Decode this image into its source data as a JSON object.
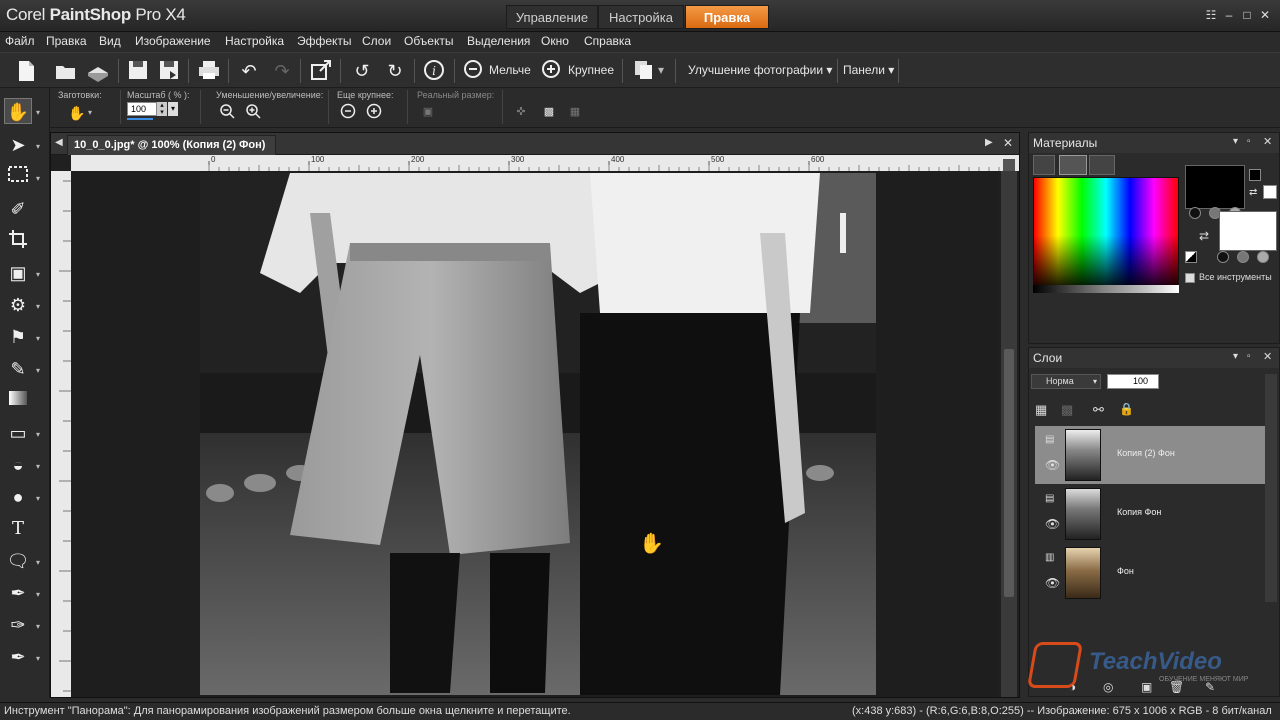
{
  "app": {
    "title_light": "Corel ",
    "title_bold": "PaintShop",
    "title_rest": " Pro X4"
  },
  "workspace_tabs": [
    {
      "label": "Управление"
    },
    {
      "label": "Настройка"
    },
    {
      "label": "Правка"
    }
  ],
  "window_buttons": {
    "grid_icon": "☷",
    "minimize": "–",
    "maximize": "□",
    "close": "✕"
  },
  "menu": [
    "Файл",
    "Правка",
    "Вид",
    "Изображение",
    "Настройка",
    "Эффекты",
    "Слои",
    "Объекты",
    "Выделения",
    "Окно",
    "Справка"
  ],
  "toolbar": {
    "zoom_out_label": "Мельче",
    "zoom_in_label": "Крупнее",
    "enhance_label": "Улучшение фотографии",
    "panels_label": "Панели"
  },
  "options": {
    "presets_label": "Заготовки:",
    "zoom_label": "Масштаб ( % ):",
    "zoom_value": "100",
    "zoom_step_label": "Уменьшение/увеличение:",
    "more_label": "Еще крупнее:",
    "actual_size_label": "Реальный размер:"
  },
  "document": {
    "tab_title": "10_0_0.jpg* @ 100% (Копия (2) Фон)",
    "ruler_ticks": [
      "0",
      "100",
      "200",
      "300",
      "400",
      "500",
      "600"
    ]
  },
  "materials": {
    "title": "Материалы",
    "all_tools_label": "Все инструменты"
  },
  "layers": {
    "title": "Слои",
    "blend_mode": "Норма",
    "opacity": "100",
    "items": [
      {
        "name": "Копия (2) Фон",
        "active": true
      },
      {
        "name": "Копия Фон",
        "active": false
      },
      {
        "name": "Фон",
        "active": false
      }
    ]
  },
  "watermark": {
    "brand": "TeachVideo",
    "tagline": "ОБУЧЕНИЕ МЕНЯЮТ МИР"
  },
  "status": {
    "left": "Инструмент \"Панорама\": Для панорамирования изображений размером больше окна щелкните и перетащите.",
    "coords": "(x:438 y:683) - (R:6,G:6,B:8,O:255) -- Изображение:  675 x 1006 x RGB - 8 бит/канал"
  },
  "colors": {
    "accent": "#e6822a",
    "panel_bg": "#2b2b2b",
    "active_layer": "#8c8c8c"
  }
}
